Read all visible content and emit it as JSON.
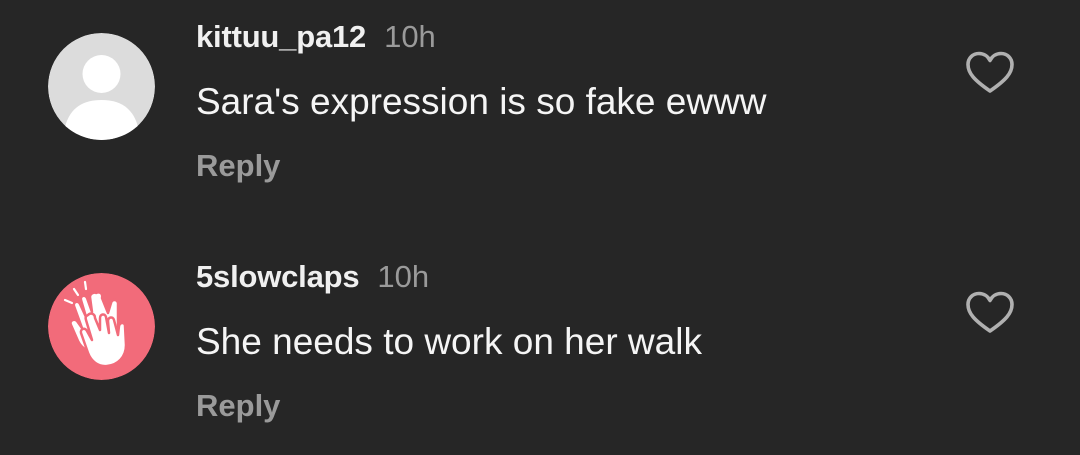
{
  "comments": [
    {
      "username": "kittuu_pa12",
      "time": "10h",
      "text": "Sara's expression is so fake ewww",
      "reply_label": "Reply",
      "avatar_icon": "default-user-avatar",
      "avatar_color": "#dcdcdc"
    },
    {
      "username": "5slowclaps",
      "time": "10h",
      "text": "She needs to work on her walk",
      "reply_label": "Reply",
      "avatar_icon": "clapping-hands-icon",
      "avatar_color": "#f26b7a"
    }
  ],
  "like_icon": "heart-outline-icon",
  "colors": {
    "background": "#262626",
    "primary_text": "#f5f5f5",
    "secondary_text": "#9a9a9a"
  }
}
